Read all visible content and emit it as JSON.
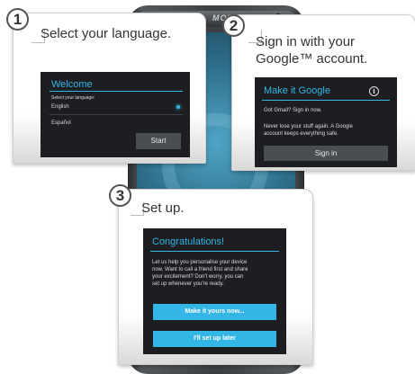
{
  "phone": {
    "brand": "MOTOROLA"
  },
  "step1": {
    "number": "1",
    "title": "Select your language.",
    "screen": {
      "heading": "Welcome",
      "prompt": "Select your language:",
      "options": [
        "English",
        "Español"
      ],
      "selected": "English",
      "start_label": "Start"
    }
  },
  "step2": {
    "number": "2",
    "title_line1": "Sign in with your",
    "title_line2": "Google™ account.",
    "screen": {
      "heading": "Make it Google",
      "info_glyph": "i",
      "line1": "Got Gmail? Sign in now.",
      "line2": "Never lose your stuff again. A Google",
      "line3": "account keeps everything safe.",
      "signin_label": "Sign in"
    }
  },
  "step3": {
    "number": "3",
    "title": "Set up.",
    "screen": {
      "heading": "Congratulations!",
      "body": [
        "Let us help you personalise your device",
        "now. Want to call a friend first and share",
        "your excitement? Don't worry, you can",
        "set up whenever you're ready."
      ],
      "primary_label": "Make it yours now...",
      "secondary_label": "I'll set up later"
    }
  },
  "colors": {
    "accent": "#33b5e5",
    "screen_bg": "#1c1e21"
  }
}
